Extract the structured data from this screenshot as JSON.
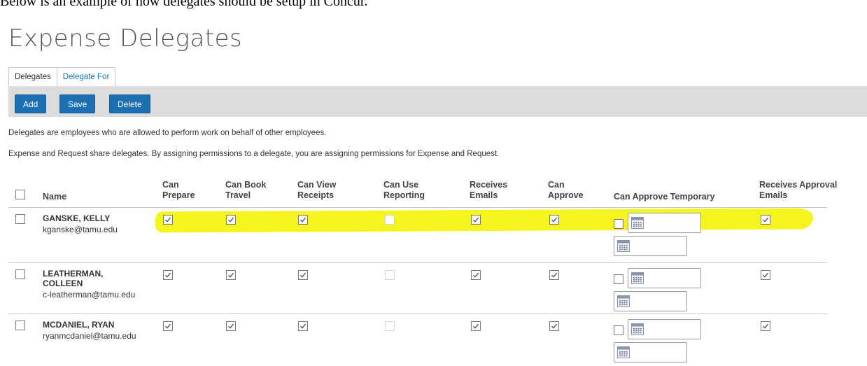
{
  "intro_text": "Below is an example of how delegates should be setup in Concur.",
  "page_title": "Expense Delegates",
  "tabs": [
    {
      "label": "Delegates"
    },
    {
      "label": "Delegate For"
    }
  ],
  "toolbar": {
    "add_label": "Add",
    "save_label": "Save",
    "delete_label": "Delete"
  },
  "description": {
    "line1": "Delegates are employees who are allowed to perform work on behalf of other employees.",
    "line2": "Expense and Request share delegates. By assigning permissions to a delegate, you are assigning permissions for Expense and Request."
  },
  "columns": {
    "name": "Name",
    "can_prepare": [
      "Can",
      "Prepare"
    ],
    "can_book_travel": [
      "Can Book",
      "Travel"
    ],
    "can_view_receipts": [
      "Can View",
      "Receipts"
    ],
    "can_use_reporting": [
      "Can Use",
      "Reporting"
    ],
    "receives_emails": [
      "Receives",
      "Emails"
    ],
    "can_approve": [
      "Can",
      "Approve"
    ],
    "can_approve_temporary": "Can Approve Temporary",
    "receives_approval_emails": [
      "Receives Approval",
      "Emails"
    ]
  },
  "rows": [
    {
      "name_lines": [
        "GANSKE, KELLY"
      ],
      "email": "kganske@tamu.edu",
      "selected": false,
      "can_prepare": true,
      "can_book_travel": true,
      "can_view_receipts": true,
      "can_use_reporting": false,
      "receives_emails": true,
      "can_approve": true,
      "can_approve_temporary": false,
      "receives_approval_emails": true,
      "highlighted": true
    },
    {
      "name_lines": [
        "LEATHERMAN,",
        "COLLEEN"
      ],
      "email": "c-leatherman@tamu.edu",
      "selected": false,
      "can_prepare": true,
      "can_book_travel": true,
      "can_view_receipts": true,
      "can_use_reporting": false,
      "receives_emails": true,
      "can_approve": true,
      "can_approve_temporary": false,
      "receives_approval_emails": true,
      "highlighted": false
    },
    {
      "name_lines": [
        "MCDANIEL, RYAN"
      ],
      "email": "ryanmcdaniel@tamu.edu",
      "selected": false,
      "can_prepare": true,
      "can_book_travel": true,
      "can_view_receipts": true,
      "can_use_reporting": false,
      "receives_emails": true,
      "can_approve": true,
      "can_approve_temporary": false,
      "receives_approval_emails": true,
      "highlighted": false
    }
  ],
  "colors": {
    "accent": "#1d6fb3",
    "highlight": "#f4f41e",
    "toolbar_bg": "#dcdcdc"
  }
}
